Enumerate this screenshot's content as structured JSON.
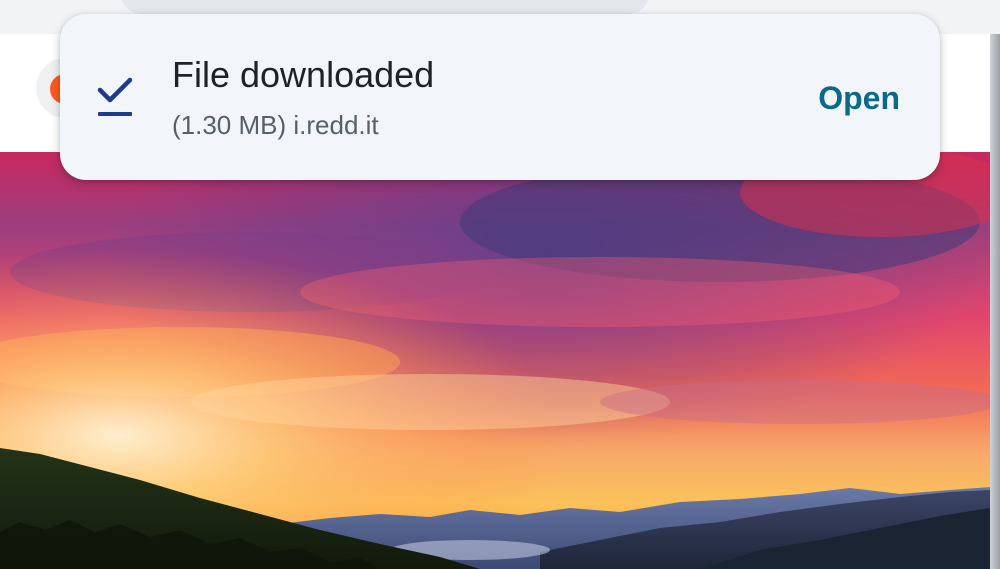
{
  "snackbar": {
    "title": "File downloaded",
    "subtitle": "(1.30 MB) i.redd.it",
    "action_label": "Open",
    "icon": "download-done-icon",
    "accent_color": "#0b6a86"
  },
  "page": {
    "site_avatar_icon": "reddit-logo-icon",
    "image": "sunset-mountain-landscape"
  }
}
